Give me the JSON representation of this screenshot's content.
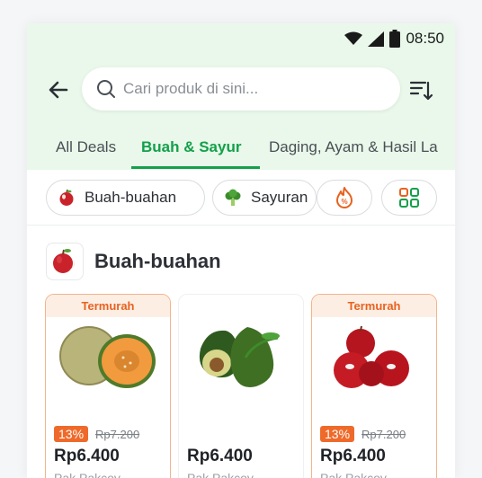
{
  "status_bar": {
    "time": "08:50"
  },
  "search": {
    "placeholder": "Cari produk di sini..."
  },
  "tabs": [
    {
      "label": "All Deals"
    },
    {
      "label": "Buah & Sayur"
    },
    {
      "label": "Daging, Ayam & Hasil La"
    }
  ],
  "chips": [
    {
      "label": "Buah-buahan",
      "icon": "apple-icon"
    },
    {
      "label": "Sayuran",
      "icon": "broccoli-icon"
    },
    {
      "label": "",
      "icon": "flame-discount-icon"
    },
    {
      "label": "",
      "icon": "grid-icon"
    }
  ],
  "section": {
    "title": "Buah-buahan",
    "icon": "apple-icon"
  },
  "products": [
    {
      "ribbon": "Termurah",
      "discount": "13%",
      "old_price": "Rp7.200",
      "price": "Rp6.400",
      "shop": "Pak Pakcoy",
      "image": "cantaloupe"
    },
    {
      "ribbon": "",
      "discount": "",
      "old_price": "",
      "price": "Rp6.400",
      "shop": "Pak Pakcoy",
      "image": "avocado"
    },
    {
      "ribbon": "Termurah",
      "discount": "13%",
      "old_price": "Rp7.200",
      "price": "Rp6.400",
      "shop": "Pak Pakcoy",
      "image": "red-apples"
    }
  ],
  "colors": {
    "accent_green": "#13a04a",
    "deal_orange": "#ef6a2a",
    "header_bg": "#e9f8ea"
  }
}
